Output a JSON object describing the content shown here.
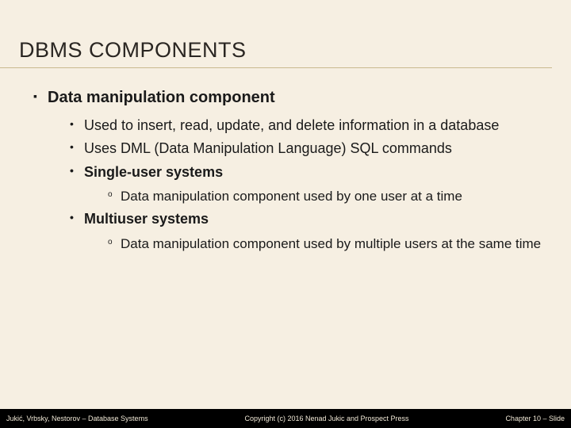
{
  "title": "DBMS COMPONENTS",
  "section": "Data manipulation component",
  "bullets": {
    "b1": "Used to insert, read, update, and delete information in a database",
    "b2": "Uses DML (Data Manipulation Language) SQL commands",
    "b3": "Single-user systems",
    "b3sub": "Data manipulation component used by one user at a time",
    "b4": "Multiuser systems",
    "b4sub": "Data manipulation component used by multiple users at the same time"
  },
  "footer": {
    "left": "Jukić, Vrbsky, Nestorov – Database Systems",
    "center": "Copyright (c) 2016 Nenad Jukic and Prospect Press",
    "right": "Chapter 10 – Slide"
  }
}
